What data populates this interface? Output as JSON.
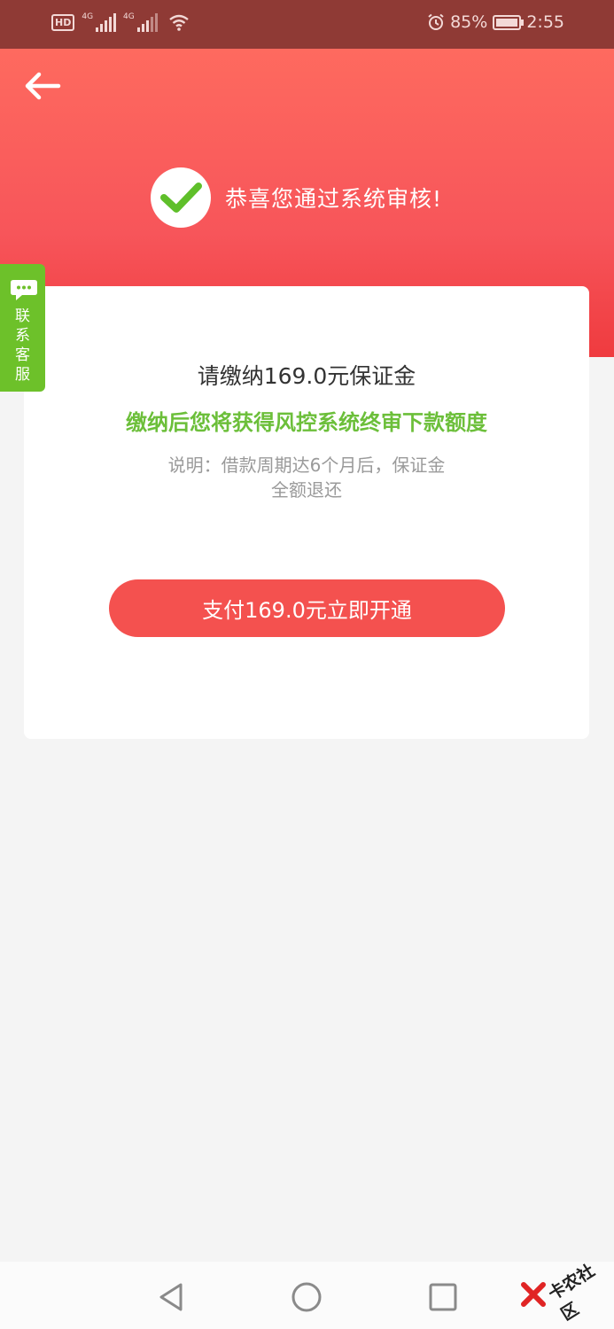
{
  "status_bar": {
    "hd_label": "HD",
    "network1": "4G",
    "network2": "4G",
    "battery": "85%",
    "time": "2:55"
  },
  "header": {
    "success_text": "恭喜您通过系统审核!"
  },
  "card": {
    "title": "请缴纳169.0元保证金",
    "subtitle": "缴纳后您将获得风控系统终审下款额度",
    "note_line1": "说明：借款周期达6个月后，保证金",
    "note_line2": "全额退还",
    "pay_button": "支付169.0元立即开通"
  },
  "service_tab": {
    "label_chars": [
      "联",
      "系",
      "客",
      "服"
    ]
  },
  "watermark": {
    "text": "卡农社区"
  },
  "colors": {
    "status_bar": "#8f3a35",
    "header_top": "#fe6a5f",
    "header_bottom": "#ef3b3f",
    "accent_red": "#f4514f",
    "accent_green": "#6dc12a"
  }
}
